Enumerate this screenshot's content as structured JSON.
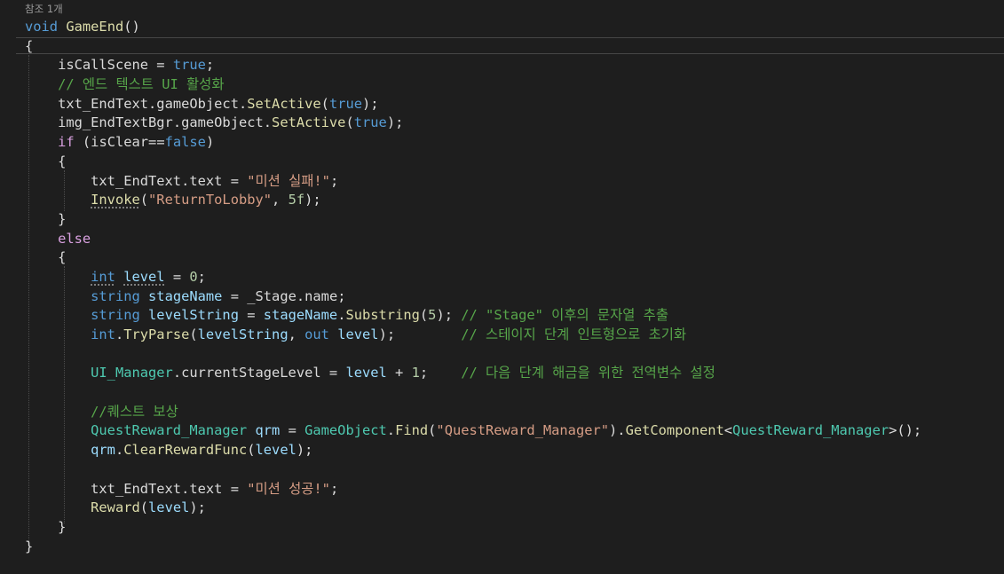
{
  "codelens": "참조 1개",
  "lines": [
    {
      "indent": 0,
      "tokens": [
        {
          "c": "kw",
          "t": "void"
        },
        {
          "c": "",
          "t": " "
        },
        {
          "c": "mth",
          "t": "GameEnd"
        },
        {
          "c": "",
          "t": "()"
        }
      ]
    },
    {
      "indent": 0,
      "tokens": [
        {
          "c": "",
          "t": "{"
        }
      ]
    },
    {
      "indent": 1,
      "tokens": [
        {
          "c": "fld",
          "t": "isCallScene"
        },
        {
          "c": "",
          "t": " = "
        },
        {
          "c": "kw",
          "t": "true"
        },
        {
          "c": "",
          "t": ";"
        }
      ]
    },
    {
      "indent": 1,
      "tokens": [
        {
          "c": "cmt",
          "t": "// 엔드 텍스트 UI 활성화"
        }
      ]
    },
    {
      "indent": 1,
      "tokens": [
        {
          "c": "fld",
          "t": "txt_EndText"
        },
        {
          "c": "",
          "t": "."
        },
        {
          "c": "fld",
          "t": "gameObject"
        },
        {
          "c": "",
          "t": "."
        },
        {
          "c": "mth",
          "t": "SetActive"
        },
        {
          "c": "",
          "t": "("
        },
        {
          "c": "kw",
          "t": "true"
        },
        {
          "c": "",
          "t": ");"
        }
      ]
    },
    {
      "indent": 1,
      "tokens": [
        {
          "c": "fld",
          "t": "img_EndTextBgr"
        },
        {
          "c": "",
          "t": "."
        },
        {
          "c": "fld",
          "t": "gameObject"
        },
        {
          "c": "",
          "t": "."
        },
        {
          "c": "mth",
          "t": "SetActive"
        },
        {
          "c": "",
          "t": "("
        },
        {
          "c": "kw",
          "t": "true"
        },
        {
          "c": "",
          "t": ");"
        }
      ]
    },
    {
      "indent": 1,
      "tokens": [
        {
          "c": "ctl",
          "t": "if"
        },
        {
          "c": "",
          "t": " ("
        },
        {
          "c": "fld",
          "t": "isClear"
        },
        {
          "c": "",
          "t": "=="
        },
        {
          "c": "kw",
          "t": "false"
        },
        {
          "c": "",
          "t": ")"
        }
      ]
    },
    {
      "indent": 1,
      "tokens": [
        {
          "c": "",
          "t": "{"
        }
      ]
    },
    {
      "indent": 2,
      "tokens": [
        {
          "c": "fld",
          "t": "txt_EndText"
        },
        {
          "c": "",
          "t": "."
        },
        {
          "c": "fld",
          "t": "text"
        },
        {
          "c": "",
          "t": " = "
        },
        {
          "c": "str",
          "t": "\"미션 실패!\""
        },
        {
          "c": "",
          "t": ";"
        }
      ]
    },
    {
      "indent": 2,
      "tokens": [
        {
          "c": "mth dot-under",
          "t": "Invoke"
        },
        {
          "c": "",
          "t": "("
        },
        {
          "c": "str",
          "t": "\"ReturnToLobby\""
        },
        {
          "c": "",
          "t": ", "
        },
        {
          "c": "num",
          "t": "5f"
        },
        {
          "c": "",
          "t": ");"
        }
      ]
    },
    {
      "indent": 1,
      "tokens": [
        {
          "c": "",
          "t": "}"
        }
      ]
    },
    {
      "indent": 1,
      "tokens": [
        {
          "c": "ctl",
          "t": "else"
        }
      ]
    },
    {
      "indent": 1,
      "tokens": [
        {
          "c": "",
          "t": "{"
        }
      ]
    },
    {
      "indent": 2,
      "tokens": [
        {
          "c": "kw dot-under",
          "t": "int"
        },
        {
          "c": "",
          "t": " "
        },
        {
          "c": "loc dot-under",
          "t": "level"
        },
        {
          "c": "",
          "t": " = "
        },
        {
          "c": "num",
          "t": "0"
        },
        {
          "c": "",
          "t": ";"
        }
      ]
    },
    {
      "indent": 2,
      "tokens": [
        {
          "c": "kw",
          "t": "string"
        },
        {
          "c": "",
          "t": " "
        },
        {
          "c": "loc",
          "t": "stageName"
        },
        {
          "c": "",
          "t": " = "
        },
        {
          "c": "fld",
          "t": "_Stage"
        },
        {
          "c": "",
          "t": "."
        },
        {
          "c": "fld",
          "t": "name"
        },
        {
          "c": "",
          "t": ";"
        }
      ]
    },
    {
      "indent": 2,
      "tokens": [
        {
          "c": "kw",
          "t": "string"
        },
        {
          "c": "",
          "t": " "
        },
        {
          "c": "loc",
          "t": "levelString"
        },
        {
          "c": "",
          "t": " = "
        },
        {
          "c": "loc",
          "t": "stageName"
        },
        {
          "c": "",
          "t": "."
        },
        {
          "c": "mth",
          "t": "Substring"
        },
        {
          "c": "",
          "t": "("
        },
        {
          "c": "num",
          "t": "5"
        },
        {
          "c": "",
          "t": "); "
        },
        {
          "c": "cmt",
          "t": "// \"Stage\" 이후의 문자열 추출"
        }
      ]
    },
    {
      "indent": 2,
      "tokens": [
        {
          "c": "kw",
          "t": "int"
        },
        {
          "c": "",
          "t": "."
        },
        {
          "c": "mth",
          "t": "TryParse"
        },
        {
          "c": "",
          "t": "("
        },
        {
          "c": "loc",
          "t": "levelString"
        },
        {
          "c": "",
          "t": ", "
        },
        {
          "c": "kw",
          "t": "out"
        },
        {
          "c": "",
          "t": " "
        },
        {
          "c": "loc",
          "t": "level"
        },
        {
          "c": "",
          "t": ");        "
        },
        {
          "c": "cmt",
          "t": "// 스테이지 단계 인트형으로 초기화"
        }
      ]
    },
    {
      "indent": 2,
      "tokens": []
    },
    {
      "indent": 2,
      "tokens": [
        {
          "c": "type",
          "t": "UI_Manager"
        },
        {
          "c": "",
          "t": "."
        },
        {
          "c": "fld",
          "t": "currentStageLevel"
        },
        {
          "c": "",
          "t": " = "
        },
        {
          "c": "loc",
          "t": "level"
        },
        {
          "c": "",
          "t": " + "
        },
        {
          "c": "num",
          "t": "1"
        },
        {
          "c": "",
          "t": ";    "
        },
        {
          "c": "cmt",
          "t": "// 다음 단계 해금을 위한 전역변수 설정"
        }
      ]
    },
    {
      "indent": 2,
      "tokens": []
    },
    {
      "indent": 2,
      "tokens": [
        {
          "c": "cmt",
          "t": "//퀘스트 보상"
        }
      ]
    },
    {
      "indent": 2,
      "tokens": [
        {
          "c": "type",
          "t": "QuestReward_Manager"
        },
        {
          "c": "",
          "t": " "
        },
        {
          "c": "loc",
          "t": "qrm"
        },
        {
          "c": "",
          "t": " = "
        },
        {
          "c": "type",
          "t": "GameObject"
        },
        {
          "c": "",
          "t": "."
        },
        {
          "c": "mth",
          "t": "Find"
        },
        {
          "c": "",
          "t": "("
        },
        {
          "c": "str",
          "t": "\"QuestReward_Manager\""
        },
        {
          "c": "",
          "t": ")."
        },
        {
          "c": "mth",
          "t": "GetComponent"
        },
        {
          "c": "",
          "t": "<"
        },
        {
          "c": "type",
          "t": "QuestReward_Manager"
        },
        {
          "c": "",
          "t": ">();"
        }
      ]
    },
    {
      "indent": 2,
      "tokens": [
        {
          "c": "loc",
          "t": "qrm"
        },
        {
          "c": "",
          "t": "."
        },
        {
          "c": "mth",
          "t": "ClearRewardFunc"
        },
        {
          "c": "",
          "t": "("
        },
        {
          "c": "loc",
          "t": "level"
        },
        {
          "c": "",
          "t": ");"
        }
      ]
    },
    {
      "indent": 2,
      "tokens": []
    },
    {
      "indent": 2,
      "tokens": [
        {
          "c": "fld",
          "t": "txt_EndText"
        },
        {
          "c": "",
          "t": "."
        },
        {
          "c": "fld",
          "t": "text"
        },
        {
          "c": "",
          "t": " = "
        },
        {
          "c": "str",
          "t": "\"미션 성공!\""
        },
        {
          "c": "",
          "t": ";"
        }
      ]
    },
    {
      "indent": 2,
      "tokens": [
        {
          "c": "mth",
          "t": "Reward"
        },
        {
          "c": "",
          "t": "("
        },
        {
          "c": "loc",
          "t": "level"
        },
        {
          "c": "",
          "t": ");"
        }
      ]
    },
    {
      "indent": 1,
      "tokens": [
        {
          "c": "",
          "t": "}"
        }
      ]
    },
    {
      "indent": 0,
      "tokens": [
        {
          "c": "",
          "t": "}"
        }
      ]
    }
  ]
}
